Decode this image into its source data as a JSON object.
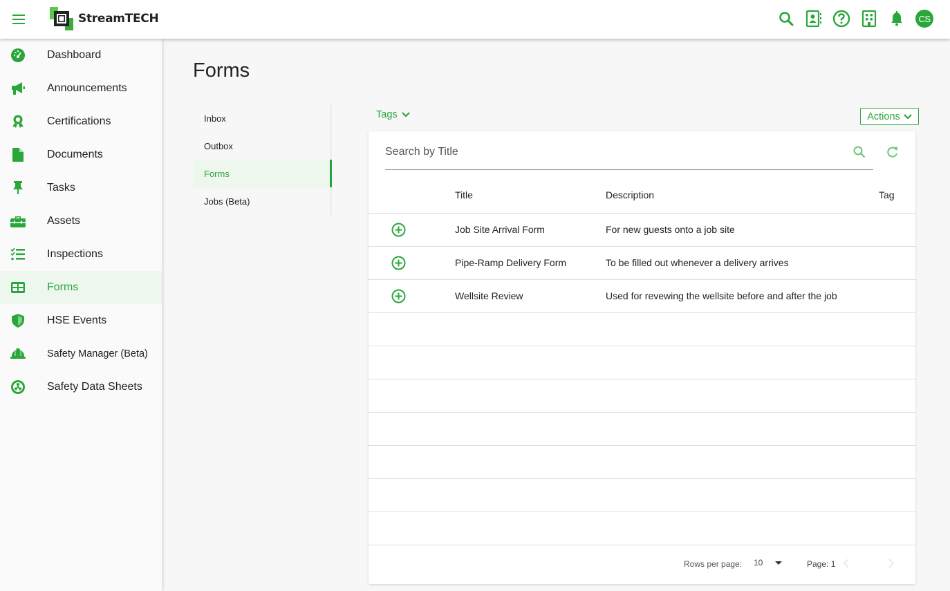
{
  "app": {
    "brand": "StreamTECH",
    "user_initials": "CS",
    "accent_color": "#2aa63a"
  },
  "topbar": {
    "icons": [
      "search-icon",
      "contacts-icon",
      "help-icon",
      "building-icon",
      "bell-icon",
      "avatar"
    ]
  },
  "sidebar": {
    "items": [
      {
        "label": "Dashboard",
        "icon": "dashboard-icon"
      },
      {
        "label": "Announcements",
        "icon": "megaphone-icon"
      },
      {
        "label": "Certifications",
        "icon": "award-icon"
      },
      {
        "label": "Documents",
        "icon": "document-icon"
      },
      {
        "label": "Tasks",
        "icon": "pin-icon"
      },
      {
        "label": "Assets",
        "icon": "toolbox-icon"
      },
      {
        "label": "Inspections",
        "icon": "checklist-icon"
      },
      {
        "label": "Forms",
        "icon": "form-icon",
        "active": true
      },
      {
        "label": "HSE Events",
        "icon": "shield-icon"
      },
      {
        "label": "Safety Manager (Beta)",
        "icon": "hardhat-icon"
      },
      {
        "label": "Safety Data Sheets",
        "icon": "hazard-icon"
      }
    ]
  },
  "page": {
    "title": "Forms"
  },
  "subnav": {
    "items": [
      {
        "label": "Inbox"
      },
      {
        "label": "Outbox"
      },
      {
        "label": "Forms",
        "active": true
      },
      {
        "label": "Jobs (Beta)"
      }
    ]
  },
  "toolbar": {
    "tags_label": "Tags",
    "actions_label": "Actions"
  },
  "search": {
    "placeholder": "Search by Title",
    "value": ""
  },
  "table": {
    "columns": [
      "Title",
      "Description",
      "Tag"
    ],
    "rows": [
      {
        "title": "Job Site Arrival Form",
        "description": "For new guests onto a job site",
        "tag": ""
      },
      {
        "title": "Pipe-Ramp Delivery Form",
        "description": "To be filled out whenever a delivery arrives",
        "tag": ""
      },
      {
        "title": "Wellsite Review",
        "description": "Used for revewing the wellsite before and after the job",
        "tag": ""
      }
    ],
    "empty_rows": 7
  },
  "pagination": {
    "rows_per_page_label": "Rows per page:",
    "rows_per_page": "10",
    "page_label": "Page: 1"
  }
}
